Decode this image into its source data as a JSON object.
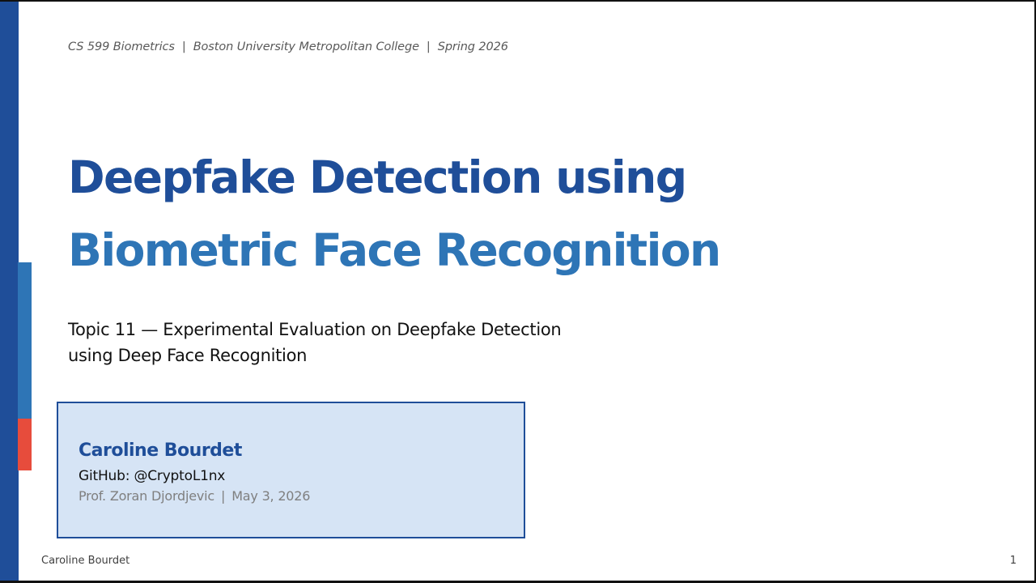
{
  "header": {
    "course": "CS 599 Biometrics",
    "separator": "|",
    "institution": "Boston University Metropolitan College",
    "term": "Spring 2026"
  },
  "title": {
    "line1": "Deepfake Detection using",
    "line2": "Biometric Face Recognition"
  },
  "subtitle": {
    "line1": "Topic 11 — Experimental Evaluation on Deepfake Detection",
    "line2": "using Deep Face Recognition"
  },
  "author_box": {
    "name": "Caroline Bourdet",
    "github": "GitHub: @CryptoL1nx",
    "professor": "Prof. Zoran Djordjevic",
    "separator": "|",
    "date": "May 3, 2026"
  },
  "footer": {
    "author": "Caroline Bourdet",
    "page_number": "1"
  },
  "colors": {
    "primary_blue": "#1f4e99",
    "secondary_blue": "#2e75b6",
    "accent_red": "#e74c3c",
    "box_fill": "#d6e4f5"
  }
}
